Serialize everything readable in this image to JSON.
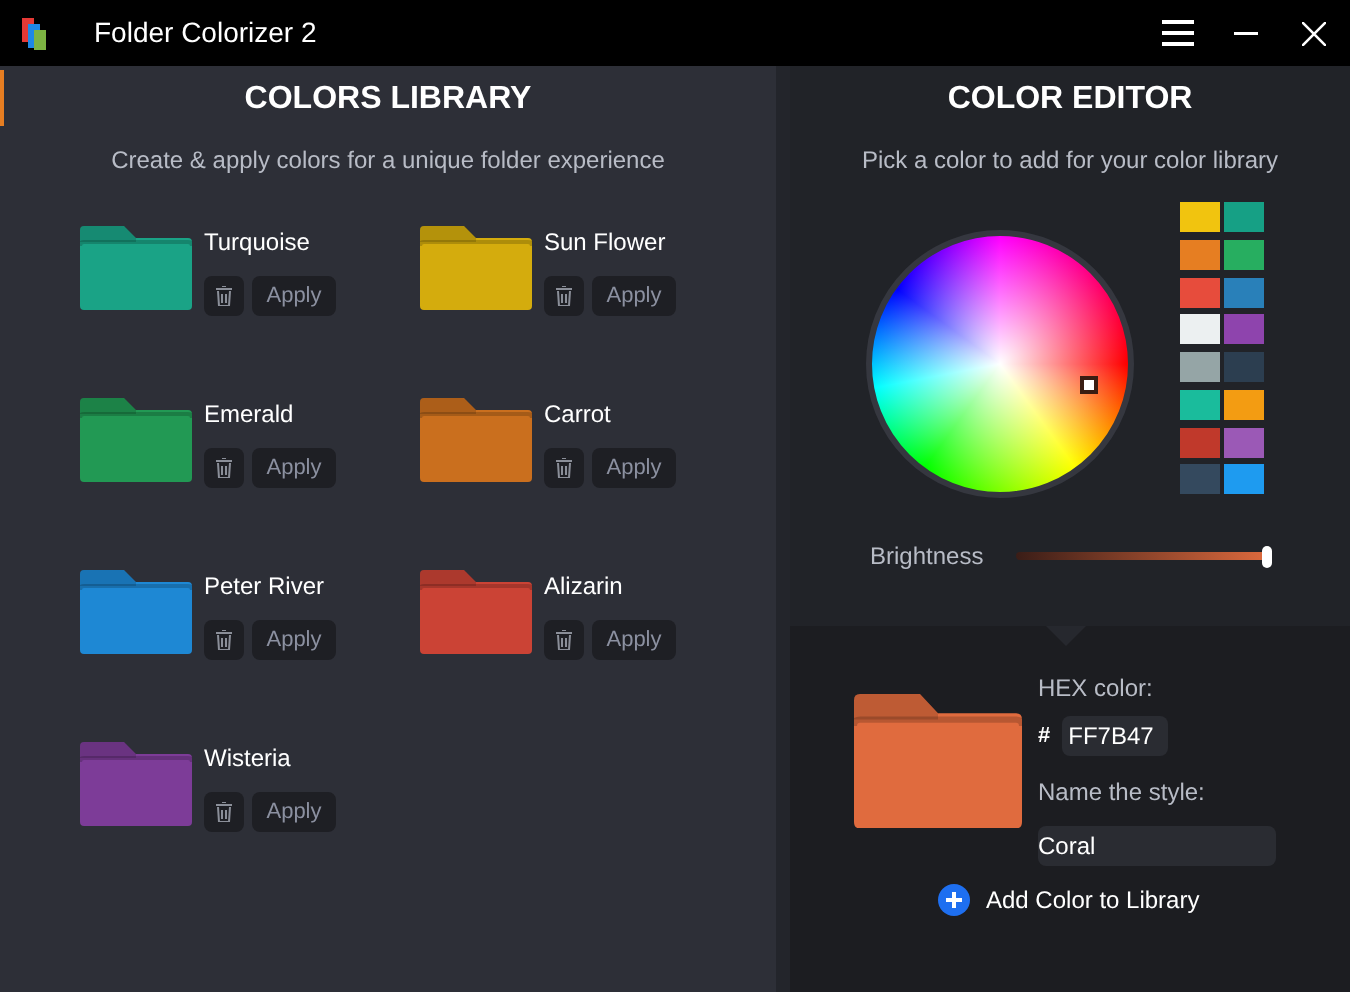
{
  "window": {
    "title": "Folder Colorizer 2"
  },
  "library": {
    "title": "COLORS LIBRARY",
    "subtitle": "Create & apply colors for a unique folder experience",
    "items": [
      {
        "name": "Turquoise",
        "color": "#1aa386",
        "apply": "Apply"
      },
      {
        "name": "Sun Flower",
        "color": "#d4ac0d",
        "apply": "Apply"
      },
      {
        "name": "Emerald",
        "color": "#229954",
        "apply": "Apply"
      },
      {
        "name": "Carrot",
        "color": "#ca6f1e",
        "apply": "Apply"
      },
      {
        "name": "Peter River",
        "color": "#1e88d4",
        "apply": "Apply"
      },
      {
        "name": "Alizarin",
        "color": "#cb4335",
        "apply": "Apply"
      },
      {
        "name": "Wisteria",
        "color": "#7d3c98",
        "apply": "Apply"
      }
    ]
  },
  "editor": {
    "title": "COLOR EDITOR",
    "subtitle": "Pick a color to add for your color library",
    "swatches": [
      {
        "color": "#f1c40f"
      },
      {
        "color": "#16a085"
      },
      {
        "color": "#e67e22"
      },
      {
        "color": "#27ae60"
      },
      {
        "color": "#e74c3c"
      },
      {
        "color": "#2980b9"
      },
      {
        "color": "#ecf0f1"
      },
      {
        "color": "#8e44ad"
      },
      {
        "color": "#95a5a6"
      },
      {
        "color": "#2c3e50"
      },
      {
        "color": "#1abc9c"
      },
      {
        "color": "#f39c12"
      },
      {
        "color": "#c0392b"
      },
      {
        "color": "#9b59b6"
      },
      {
        "color": "#34495e"
      },
      {
        "color": "#1e9bf0"
      }
    ],
    "brightness": {
      "label": "Brightness",
      "level": 1
    },
    "preview": {
      "color": "#e06b3e"
    },
    "hex_label": "HEX color:",
    "hash": "#",
    "hex_value": "FF7B47",
    "name_label": "Name the style:",
    "name_value": "Coral",
    "add_button": "Add Color to Library"
  }
}
